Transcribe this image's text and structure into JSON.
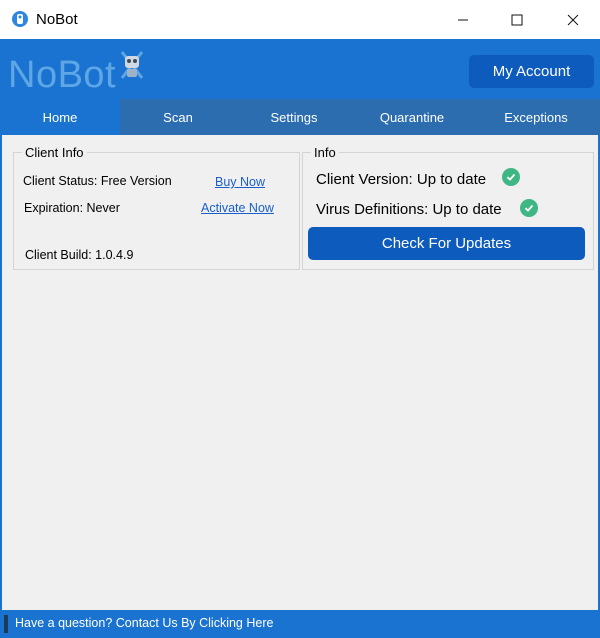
{
  "window": {
    "title": "NoBot",
    "icon": "nobot-app-icon"
  },
  "header": {
    "brand": "NoBot",
    "my_account_label": "My Account",
    "colors": {
      "header": "#1a73d1",
      "button": "#0c5bbd",
      "brand_text": "#5fa6e6"
    }
  },
  "tabs": [
    {
      "label": "Home",
      "active": true
    },
    {
      "label": "Scan",
      "active": false
    },
    {
      "label": "Settings",
      "active": false
    },
    {
      "label": "Quarantine",
      "active": false
    },
    {
      "label": "Exceptions",
      "active": false
    }
  ],
  "client_info": {
    "title": "Client Info",
    "status_label": "Client Status: Free Version",
    "buy_now": "Buy Now",
    "expiration_label": "Expiration: Never",
    "activate_now": "Activate Now",
    "build_label": "Client Build: 1.0.4.9"
  },
  "info": {
    "title": "Info",
    "client_version": "Client Version: Up to date",
    "virus_definitions": "Virus Definitions: Up to date",
    "check_updates_label": "Check For Updates",
    "status_color": "#3fb785"
  },
  "footer": {
    "text": "Have a question? Contact Us By Clicking Here"
  }
}
